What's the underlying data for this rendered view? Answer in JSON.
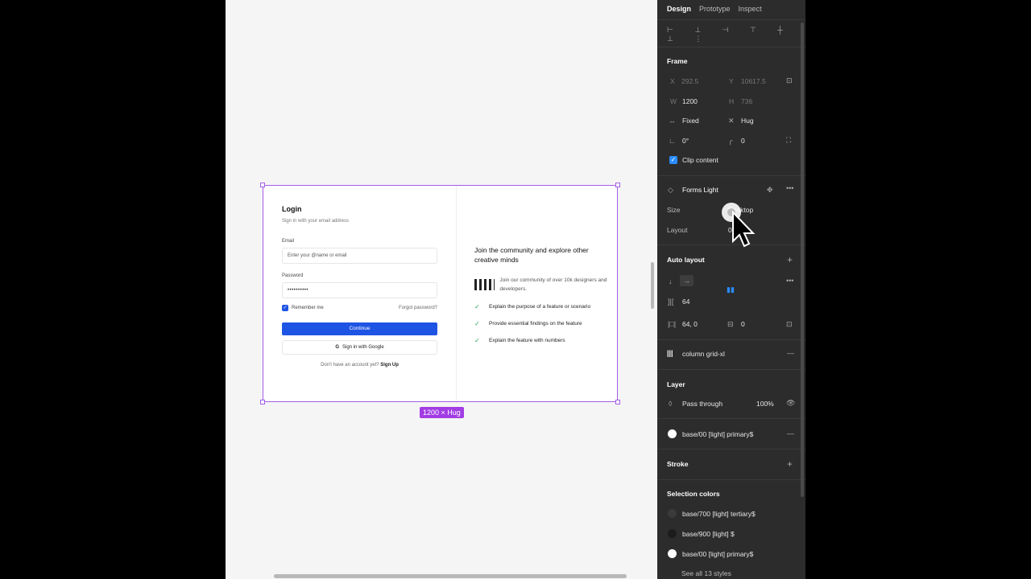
{
  "canvas": {
    "frame_size_label": "1200 × Hug",
    "login": {
      "title": "Login",
      "subtitle": "Sign in with your email address",
      "email_label": "Email",
      "email_placeholder": "Enter your @name or email",
      "password_label": "Password",
      "password_value": "••••••••••",
      "remember_label": "Remember me",
      "forgot_label": "Forgot password?",
      "continue_label": "Continue",
      "google_label": "Sign in with Google",
      "no_account_text": "Don't have an account yet?",
      "signup_label": "Sign Up"
    },
    "community": {
      "heading": "Join the community and explore other creative minds",
      "avatar_text": "Join our community of over 10k designers and developers.",
      "features": [
        "Explain the purpose of a feature or scenario",
        "Provide essential findings on the feature",
        "Explain the feature with numbers"
      ]
    }
  },
  "panel": {
    "tabs": [
      "Design",
      "Prototype",
      "Inspect"
    ],
    "frame": {
      "title": "Frame",
      "x_label": "X",
      "x_value": "292.5",
      "y_label": "Y",
      "y_value": "10617.5",
      "w_label": "W",
      "w_value": "1200",
      "h_label": "H",
      "h_value": "736",
      "width_mode": "Fixed",
      "height_mode": "Hug",
      "rotation": "0°",
      "radius": "0",
      "clip_content": "Clip content"
    },
    "component": {
      "name": "Forms Light",
      "size_label": "Size",
      "size_value": "Desktop",
      "layout_label": "Layout",
      "layout_value": "0"
    },
    "auto_layout": {
      "title": "Auto layout",
      "gap": "64",
      "padding": "64, 0",
      "padding_v": "0"
    },
    "grid": {
      "name": "column grid-xl"
    },
    "layer": {
      "title": "Layer",
      "blend": "Pass through",
      "opacity": "100%"
    },
    "fill": {
      "name": "base/00 [light] primary$"
    },
    "stroke": {
      "title": "Stroke"
    },
    "selection_colors": {
      "title": "Selection colors",
      "items": [
        "base/700 [light] tertiary$",
        "base/900 [light] $",
        "base/00 [light] primary$"
      ],
      "see_all": "See all 13 styles"
    }
  },
  "colors": {
    "accent": "#1e54e4",
    "selection": "#a45ce8",
    "panel_bg": "#2c2c2c"
  }
}
